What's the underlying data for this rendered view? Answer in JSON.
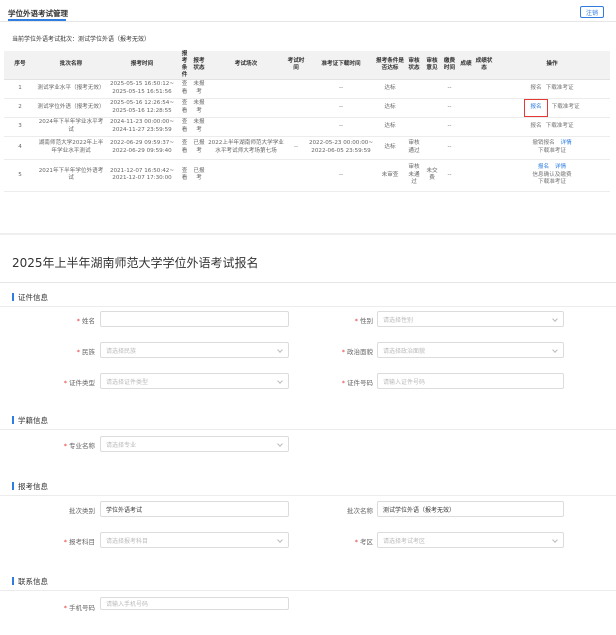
{
  "top": {
    "title": "学位外语考试管理",
    "logout": "注销",
    "batch_line": "当前学位外语考试批次：测试学位外语（报考无效）",
    "columns": [
      "序号",
      "批次名称",
      "报考时间",
      "报考条件",
      "报考状态",
      "考试场次",
      "考试时间",
      "准考证下载时间",
      "报考条件是否达标",
      "审核状态",
      "审核意见",
      "缴费时间",
      "成绩",
      "成绩状态",
      "操作"
    ],
    "rows": [
      {
        "no": "1",
        "name": "测试学业水平（报考无效）",
        "time": "2025-05-15 16:50:12~ 2025-05-15 16:51:56",
        "cond": "查看",
        "status": "未报考",
        "session": "",
        "exam_time": "",
        "ticket": "--",
        "meet": "达标",
        "audit": "",
        "opinion": "",
        "pay": "--",
        "score": "",
        "score_status": "",
        "op1": "报名",
        "op2": "下载准考证"
      },
      {
        "no": "2",
        "name": "测试学位外语（报考无效）",
        "time": "2025-05-16 12:26:54~ 2025-05-16 12:28:55",
        "cond": "查看",
        "status": "未报考",
        "session": "",
        "exam_time": "",
        "ticket": "--",
        "meet": "达标",
        "audit": "",
        "opinion": "",
        "pay": "--",
        "score": "",
        "score_status": "",
        "op1": "报名",
        "op2": "下载准考证"
      },
      {
        "no": "3",
        "name": "2024年下半年学业水平考试",
        "time": "2024-11-23 00:00:00~ 2024-11-27 23:59:59",
        "cond": "查看",
        "status": "未报考",
        "session": "",
        "exam_time": "",
        "ticket": "--",
        "meet": "达标",
        "audit": "",
        "opinion": "",
        "pay": "--",
        "score": "",
        "score_status": "",
        "op1": "报名",
        "op2": "下载准考证"
      },
      {
        "no": "4",
        "name": "湖南师范大学2022年上半年学业水平测试",
        "time": "2022-06-29 09:59:37~ 2022-06-29 09:59:40",
        "cond": "查看",
        "status": "已报考",
        "session": "2022上半年湖南师范大学学业水平考试师大考场第七场",
        "exam_time": "--",
        "ticket": "2022-05-23 00:00:00~ 2022-06-05 23:59:59",
        "meet": "达标",
        "audit": "审核通过",
        "opinion": "",
        "pay": "--",
        "score": "",
        "score_status": "",
        "op1": "撤销报名",
        "op2": "详情",
        "op3": "下载准考证"
      },
      {
        "no": "5",
        "name": "2021年下半年学位外语考试",
        "time": "2021-12-07 16:50:42~ 2021-12-07 17:30:00",
        "cond": "查看",
        "status": "已报考",
        "session": "",
        "exam_time": "",
        "ticket": "--",
        "meet": "未审查",
        "audit": "审核未通过",
        "opinion": "未交费",
        "pay": "--",
        "score": "",
        "score_status": "",
        "op1": "报名",
        "op2": "详情",
        "op3": "信息确认及缴费",
        "op4": "下载准考证"
      }
    ]
  },
  "form": {
    "title": "2025年上半年湖南师范大学学位外语考试报名",
    "sections": {
      "cert": "证件信息",
      "school": "学籍信息",
      "exam": "报考信息",
      "contact": "联系信息"
    },
    "fields": {
      "name": {
        "label": "姓名",
        "value": "",
        "placeholder": ""
      },
      "gender": {
        "label": "性别",
        "placeholder": "请选择性别"
      },
      "ethnicity": {
        "label": "民族",
        "placeholder": "请选择民族"
      },
      "political": {
        "label": "政治面貌",
        "placeholder": "请选择政治面貌"
      },
      "id_type": {
        "label": "证件类型",
        "placeholder": "请选择证件类型"
      },
      "id_number": {
        "label": "证件号码",
        "placeholder": "请输入证件号码"
      },
      "major": {
        "label": "专业名称",
        "placeholder": "请选择专业"
      },
      "batch_type": {
        "label": "批次类别",
        "value": "学位外语考试"
      },
      "batch_name": {
        "label": "批次名称",
        "value": "测试学位外语（报考无效）"
      },
      "subject": {
        "label": "报考科目",
        "placeholder": "请选择报考科目"
      },
      "area": {
        "label": "考区",
        "placeholder": "请选择考试考区"
      },
      "phone": {
        "label": "手机号码",
        "placeholder": "请输入手机号码"
      }
    }
  },
  "colors": {
    "accent": "#2f7de1",
    "required": "#e53935",
    "highlight_box": "#e53935"
  }
}
